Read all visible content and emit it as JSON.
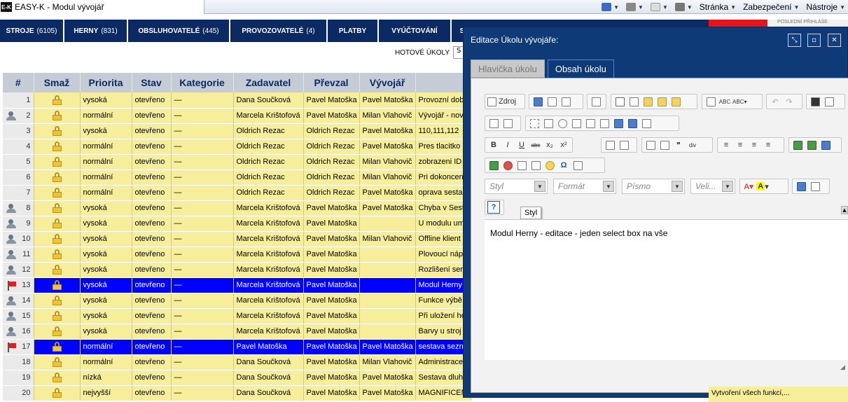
{
  "browser": {
    "favicon": "E-K",
    "tab_title": "EASY-K - Modul vývojář",
    "tools": [
      "Stránka",
      "Zabezpečení",
      "Nástroje"
    ]
  },
  "nav": [
    {
      "label": "STROJE",
      "count": "(6105)"
    },
    {
      "label": "HERNY",
      "count": "(831)"
    },
    {
      "label": "OBSLUHOVATELÉ",
      "count": "(445)"
    },
    {
      "label": "PROVOZOVATELÉ",
      "count": "(4)"
    },
    {
      "label": "PLATBY",
      "count": ""
    },
    {
      "label": "VYÚČTOVÁNÍ",
      "count": ""
    },
    {
      "label": "S",
      "count": ""
    }
  ],
  "nav_right": "POSLEDNÍ PŘIHLÁŠE",
  "filter": {
    "label": "HOTOVÉ ÚKOLY",
    "value": "S"
  },
  "table": {
    "headers": [
      "#",
      "Smaž",
      "Priorita",
      "Stav",
      "Kategorie",
      "Zadavatel",
      "Převzal",
      "Vývojář",
      ""
    ],
    "rows": [
      {
        "n": "1",
        "icon": "",
        "p": "vysoká",
        "s": "otevřeno",
        "k": "—",
        "z": "Dana Součková",
        "pr": "Pavel Matoška",
        "v": "Pavel Matoška",
        "d": "Provozní dob",
        "sel": false
      },
      {
        "n": "2",
        "icon": "people",
        "p": "normální",
        "s": "otevřeno",
        "k": "—",
        "z": "Marcela Krištofová",
        "pr": "Pavel Matoška",
        "v": "Milan Vlahovič",
        "d": "Vývojář - nov",
        "sel": false
      },
      {
        "n": "3",
        "icon": "",
        "p": "vysoká",
        "s": "otevřeno",
        "k": "—",
        "z": "Oldrich Rezac",
        "pr": "Oldrich Rezac",
        "v": "Pavel Matoška",
        "d": "110,111,112",
        "sel": false
      },
      {
        "n": "4",
        "icon": "",
        "p": "normální",
        "s": "otevřeno",
        "k": "—",
        "z": "Oldrich Rezac",
        "pr": "Oldrich Rezac",
        "v": "Pavel Matoška",
        "d": "Pres tlacitko",
        "sel": false
      },
      {
        "n": "5",
        "icon": "",
        "p": "normální",
        "s": "otevřeno",
        "k": "—",
        "z": "Oldrich Rezac",
        "pr": "Oldrich Rezac",
        "v": "Milan Vlahovič",
        "d": "zobrazeni ID",
        "sel": false
      },
      {
        "n": "6",
        "icon": "",
        "p": "normální",
        "s": "otevřeno",
        "k": "—",
        "z": "Oldrich Rezac",
        "pr": "Oldrich Rezac",
        "v": "Milan Vlahovič",
        "d": "Pri dokoncen",
        "sel": false
      },
      {
        "n": "7",
        "icon": "",
        "p": "normální",
        "s": "otevřeno",
        "k": "—",
        "z": "Oldrich Rezac",
        "pr": "Oldrich Rezac",
        "v": "Pavel Matoška",
        "d": "oprava sesta",
        "sel": false
      },
      {
        "n": "8",
        "icon": "people",
        "p": "vysoká",
        "s": "otevřeno",
        "k": "—",
        "z": "Marcela Krištofová",
        "pr": "Pavel Matoška",
        "v": "Pavel Matoška",
        "d": "Chyba v Sest",
        "sel": false
      },
      {
        "n": "9",
        "icon": "people",
        "p": "vysoká",
        "s": "otevřeno",
        "k": "—",
        "z": "Marcela Krištofová",
        "pr": "Pavel Matoška",
        "v": "",
        "d": "U modulu um",
        "sel": false
      },
      {
        "n": "10",
        "icon": "people",
        "p": "vysoká",
        "s": "otevřeno",
        "k": "—",
        "z": "Marcela Krištofová",
        "pr": "Pavel Matoška",
        "v": "Milan Vlahovič",
        "d": "Offline klient",
        "sel": false
      },
      {
        "n": "11",
        "icon": "people",
        "p": "vysoká",
        "s": "otevřeno",
        "k": "—",
        "z": "Marcela Krištofová",
        "pr": "Pavel Matoška",
        "v": "",
        "d": "Plovoucí náp",
        "sel": false
      },
      {
        "n": "12",
        "icon": "people",
        "p": "vysoká",
        "s": "otevřeno",
        "k": "—",
        "z": "Marcela Krištofová",
        "pr": "Pavel Matoška",
        "v": "",
        "d": "Rozlišení serv",
        "sel": false
      },
      {
        "n": "13",
        "icon": "flag",
        "p": "vysoká",
        "s": "otevřeno",
        "k": "—",
        "z": "Marcela Krištofová",
        "pr": "Pavel Matoška",
        "v": "",
        "d": "Modul Herny",
        "sel": true
      },
      {
        "n": "14",
        "icon": "people",
        "p": "vysoká",
        "s": "otevřeno",
        "k": "—",
        "z": "Marcela Krištofová",
        "pr": "Pavel Matoška",
        "v": "",
        "d": "Funkce výbě",
        "sel": false
      },
      {
        "n": "15",
        "icon": "people",
        "p": "vysoká",
        "s": "otevřeno",
        "k": "—",
        "z": "Marcela Krištofová",
        "pr": "Pavel Matoška",
        "v": "",
        "d": "Při uložení he",
        "sel": false
      },
      {
        "n": "16",
        "icon": "people",
        "p": "vysoká",
        "s": "otevřeno",
        "k": "—",
        "z": "Marcela Krištofová",
        "pr": "Pavel Matoška",
        "v": "",
        "d": "Barvy u stroj",
        "sel": false
      },
      {
        "n": "17",
        "icon": "flag",
        "p": "normální",
        "s": "otevřeno",
        "k": "—",
        "z": "Pavel Matoška",
        "pr": "Pavel Matoška",
        "v": "Pavel Matoška",
        "d": "sestava sezn",
        "sel": true
      },
      {
        "n": "18",
        "icon": "",
        "p": "normální",
        "s": "otevřeno",
        "k": "—",
        "z": "Dana Součková",
        "pr": "Pavel Matoška",
        "v": "Milan Vlahovič",
        "d": "Administrace",
        "sel": false
      },
      {
        "n": "19",
        "icon": "",
        "p": "nízká",
        "s": "otevřeno",
        "k": "—",
        "z": "Dana Součková",
        "pr": "Pavel Matoška",
        "v": "Pavel Matoška",
        "d": "Sestava dluh",
        "sel": false
      },
      {
        "n": "20",
        "icon": "",
        "p": "nejvyšší",
        "s": "otevřeno",
        "k": "—",
        "z": "Dana Součková",
        "pr": "Pavel Matoška",
        "v": "Pavel Matoška",
        "d": "MAGNIFICENCE - vyúčtování",
        "sel": false
      }
    ]
  },
  "modal": {
    "title": "Editace Úkolu vývojáře:",
    "tabs": [
      "Hlavička úkolu",
      "Obsah úkolu"
    ],
    "active_tab": "Obsah úkolu",
    "source_label": "Zdroj",
    "combos": [
      {
        "placeholder": "Styl"
      },
      {
        "placeholder": "Formát"
      },
      {
        "placeholder": "Písmo"
      },
      {
        "placeholder": "Veli..."
      }
    ],
    "tooltip": "Styl",
    "content": "Modul Herny - editace - jeden select box na vše",
    "help_label": "?"
  },
  "bottom_right_text": "Vytvoření všech funkcí,..."
}
